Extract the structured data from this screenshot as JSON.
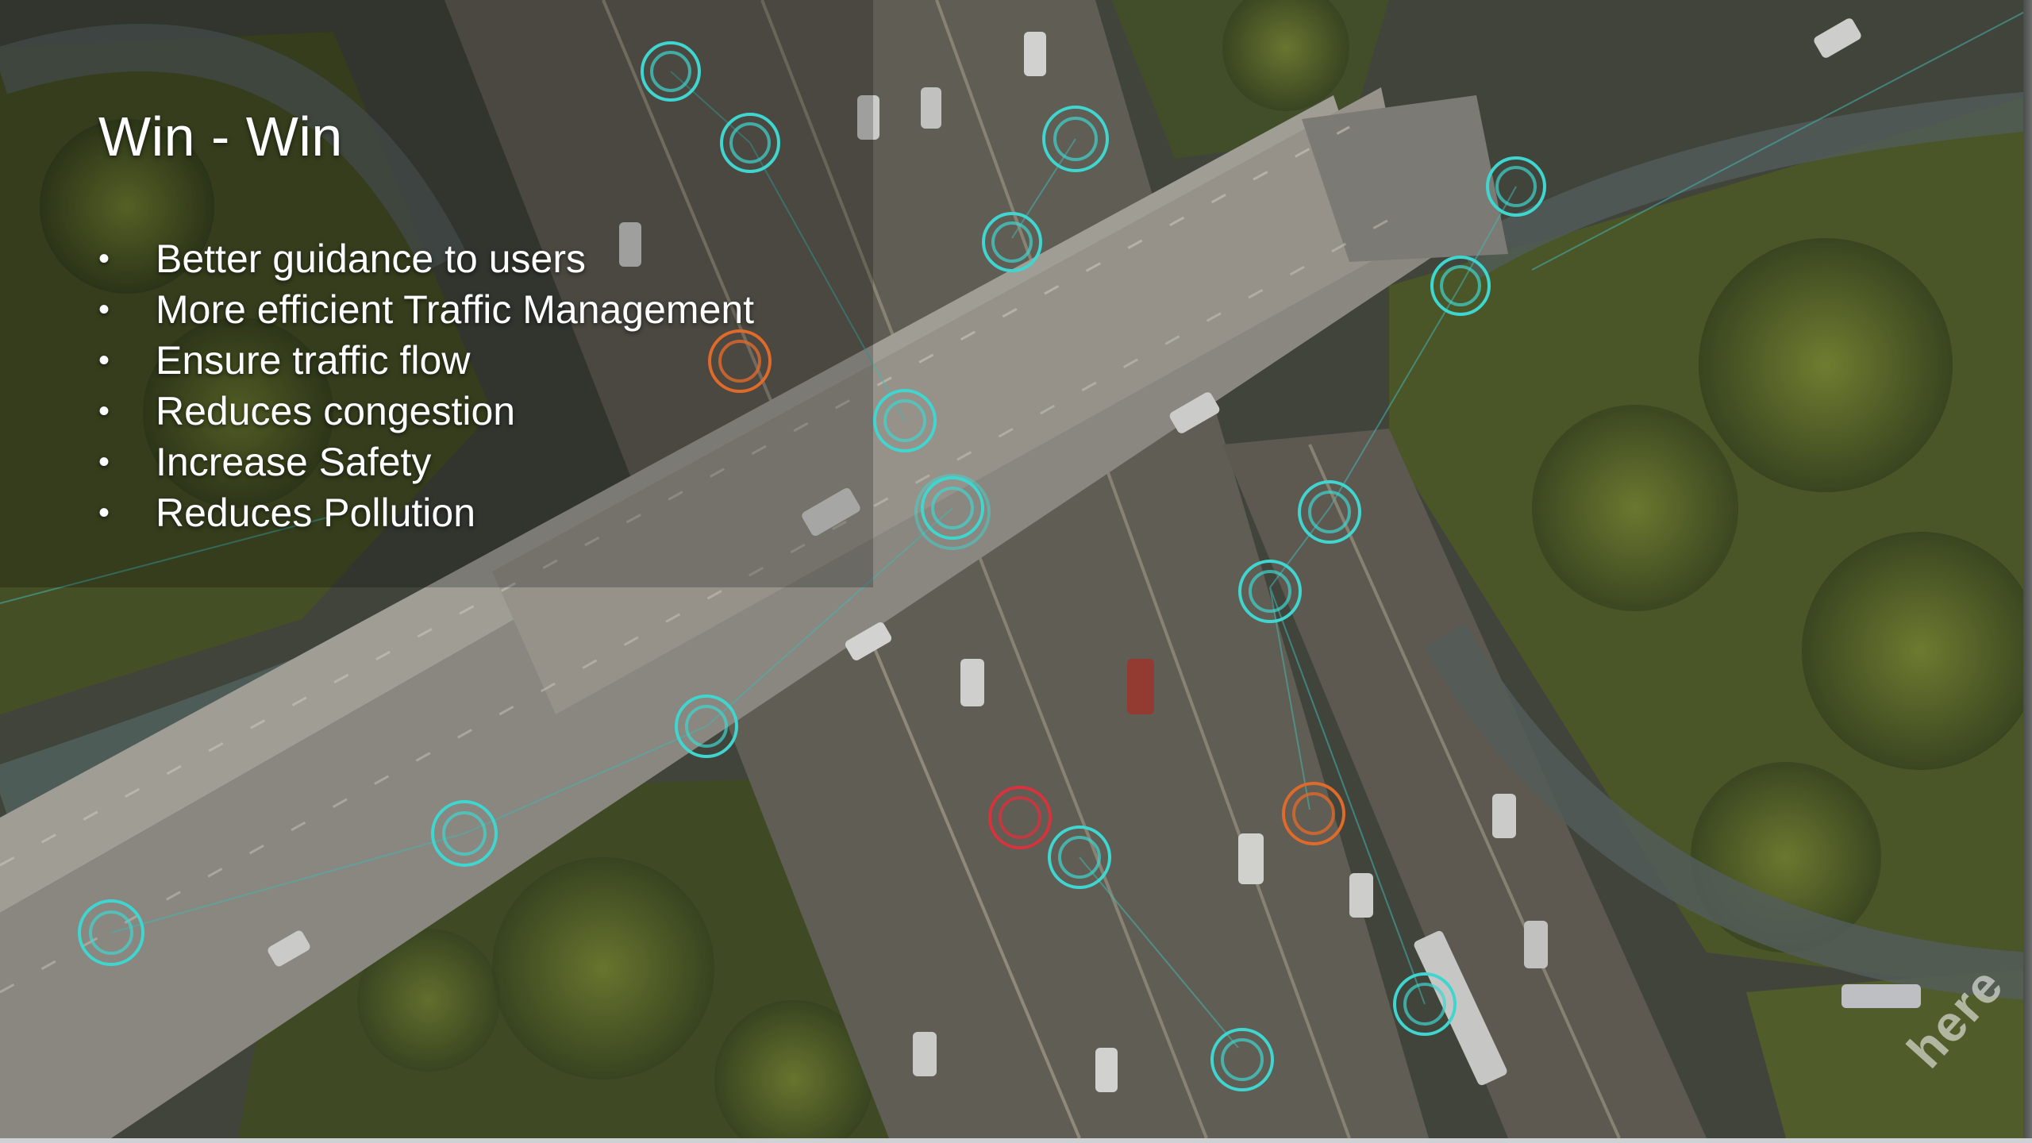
{
  "slide": {
    "title": "Win - Win",
    "bullets": [
      "Better guidance to users",
      "More efficient Traffic Management",
      "Ensure traffic flow",
      "Reduces congestion",
      "Increase Safety",
      "Reduces Pollution"
    ],
    "watermark": "here"
  },
  "colors": {
    "marker_normal": "#3fd6cf",
    "marker_warning": "#e06a2a",
    "marker_alert": "#d8323c"
  }
}
